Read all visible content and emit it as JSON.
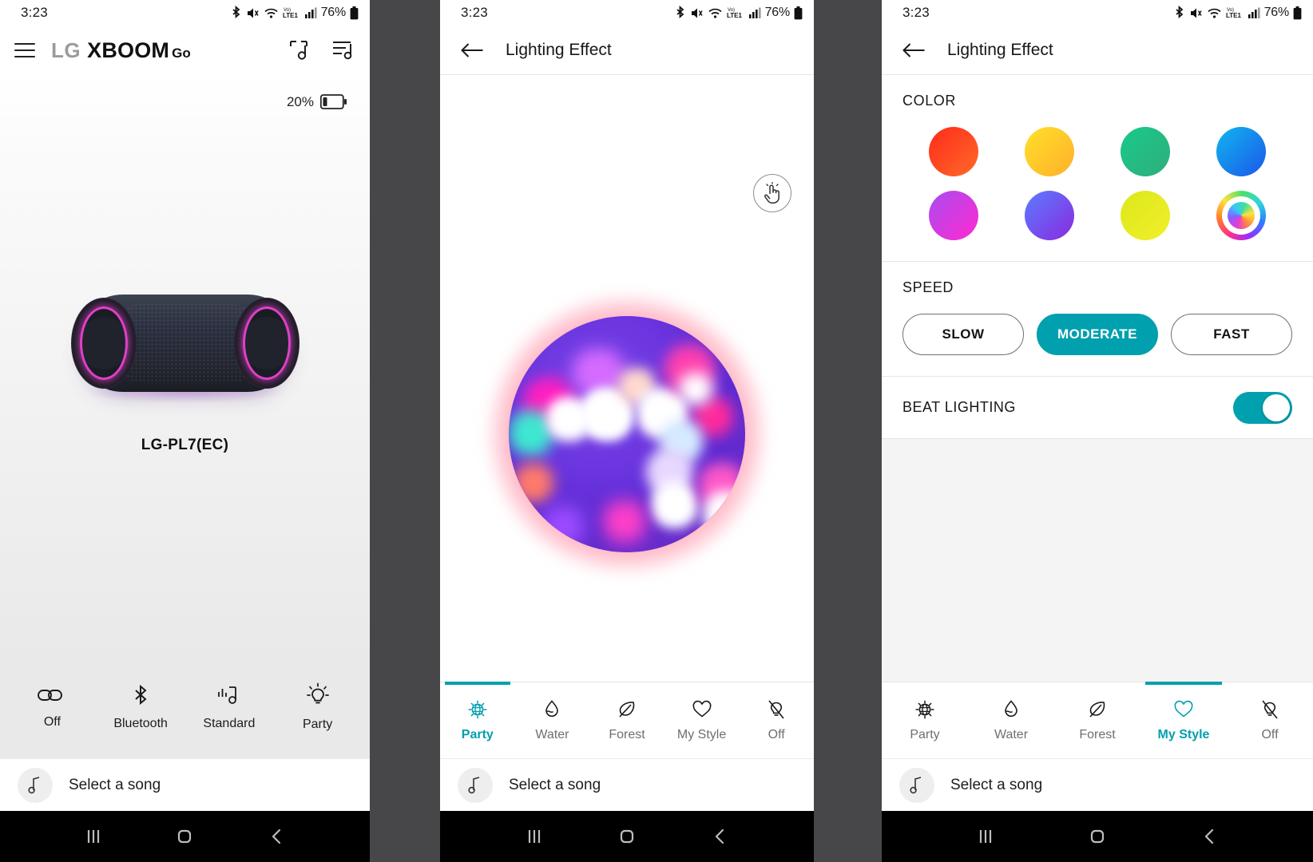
{
  "statusbar": {
    "time": "3:23",
    "battery_pct": "76%",
    "icons": [
      "bluetooth-icon",
      "mute-icon",
      "wifi-icon",
      "volte-icon",
      "signal-icon",
      "battery-icon"
    ]
  },
  "phone1": {
    "appbar": {
      "menu_icon": "hamburger-icon",
      "brand_lg": "LG",
      "brand_xboom": "XBOOM",
      "brand_go": "Go",
      "actions": [
        "multi-speaker-icon",
        "playlist-icon"
      ]
    },
    "device": {
      "battery_pct": "20%",
      "name": "LG-PL7(EC)"
    },
    "quick_controls": [
      {
        "label": "Off",
        "icon": "link-off-icon"
      },
      {
        "label": "Bluetooth",
        "icon": "bluetooth-icon"
      },
      {
        "label": "Standard",
        "icon": "sound-equalizer-icon"
      },
      {
        "label": "Party",
        "icon": "lightbulb-icon"
      }
    ],
    "songbar": {
      "icon": "music-note-icon",
      "text": "Select a song"
    }
  },
  "phone2": {
    "header": {
      "back_icon": "arrow-left-icon",
      "title": "Lighting Effect"
    },
    "touch_button": {
      "icon": "touch-hand-icon"
    },
    "preview": {
      "name": "party-bokeh-preview"
    },
    "tabs": [
      {
        "label": "Party",
        "icon": "party-globe-icon",
        "active": true
      },
      {
        "label": "Water",
        "icon": "water-drop-icon",
        "active": false
      },
      {
        "label": "Forest",
        "icon": "leaf-icon",
        "active": false
      },
      {
        "label": "My Style",
        "icon": "heart-icon",
        "active": false
      },
      {
        "label": "Off",
        "icon": "lightbulb-off-icon",
        "active": false
      }
    ],
    "songbar": {
      "icon": "music-note-icon",
      "text": "Select a song"
    }
  },
  "phone3": {
    "header": {
      "back_icon": "arrow-left-icon",
      "title": "Lighting Effect"
    },
    "color": {
      "title": "COLOR",
      "swatches": [
        {
          "name": "red",
          "from": "#ff2a1a",
          "to": "#ff6a2a"
        },
        {
          "name": "yellow",
          "from": "#ffe02a",
          "to": "#ffb02a"
        },
        {
          "name": "green",
          "from": "#19c98c",
          "to": "#2fae7a"
        },
        {
          "name": "blue",
          "from": "#11b6f0",
          "to": "#1b57e8"
        },
        {
          "name": "magenta",
          "from": "#a84cf0",
          "to": "#ff2ad0"
        },
        {
          "name": "violet",
          "from": "#5b7cff",
          "to": "#8a2ae0"
        },
        {
          "name": "lime",
          "from": "#dbe81b",
          "to": "#f2ef2a"
        },
        {
          "name": "multicolor",
          "from": "rainbow",
          "to": "rainbow"
        }
      ]
    },
    "speed": {
      "title": "SPEED",
      "options": [
        {
          "label": "SLOW",
          "selected": false
        },
        {
          "label": "MODERATE",
          "selected": true
        },
        {
          "label": "FAST",
          "selected": false
        }
      ]
    },
    "beat": {
      "label": "BEAT LIGHTING",
      "enabled": true
    },
    "tabs": [
      {
        "label": "Party",
        "icon": "party-globe-icon",
        "active": false
      },
      {
        "label": "Water",
        "icon": "water-drop-icon",
        "active": false
      },
      {
        "label": "Forest",
        "icon": "leaf-icon",
        "active": false
      },
      {
        "label": "My Style",
        "icon": "heart-icon",
        "active": true
      },
      {
        "label": "Off",
        "icon": "lightbulb-off-icon",
        "active": false
      }
    ],
    "songbar": {
      "icon": "music-note-icon",
      "text": "Select a song"
    }
  },
  "navbar": {
    "recents": "recents-icon",
    "home": "home-icon",
    "back": "back-icon"
  },
  "colors": {
    "accent": "#00a0ae",
    "bg": "#474749"
  }
}
